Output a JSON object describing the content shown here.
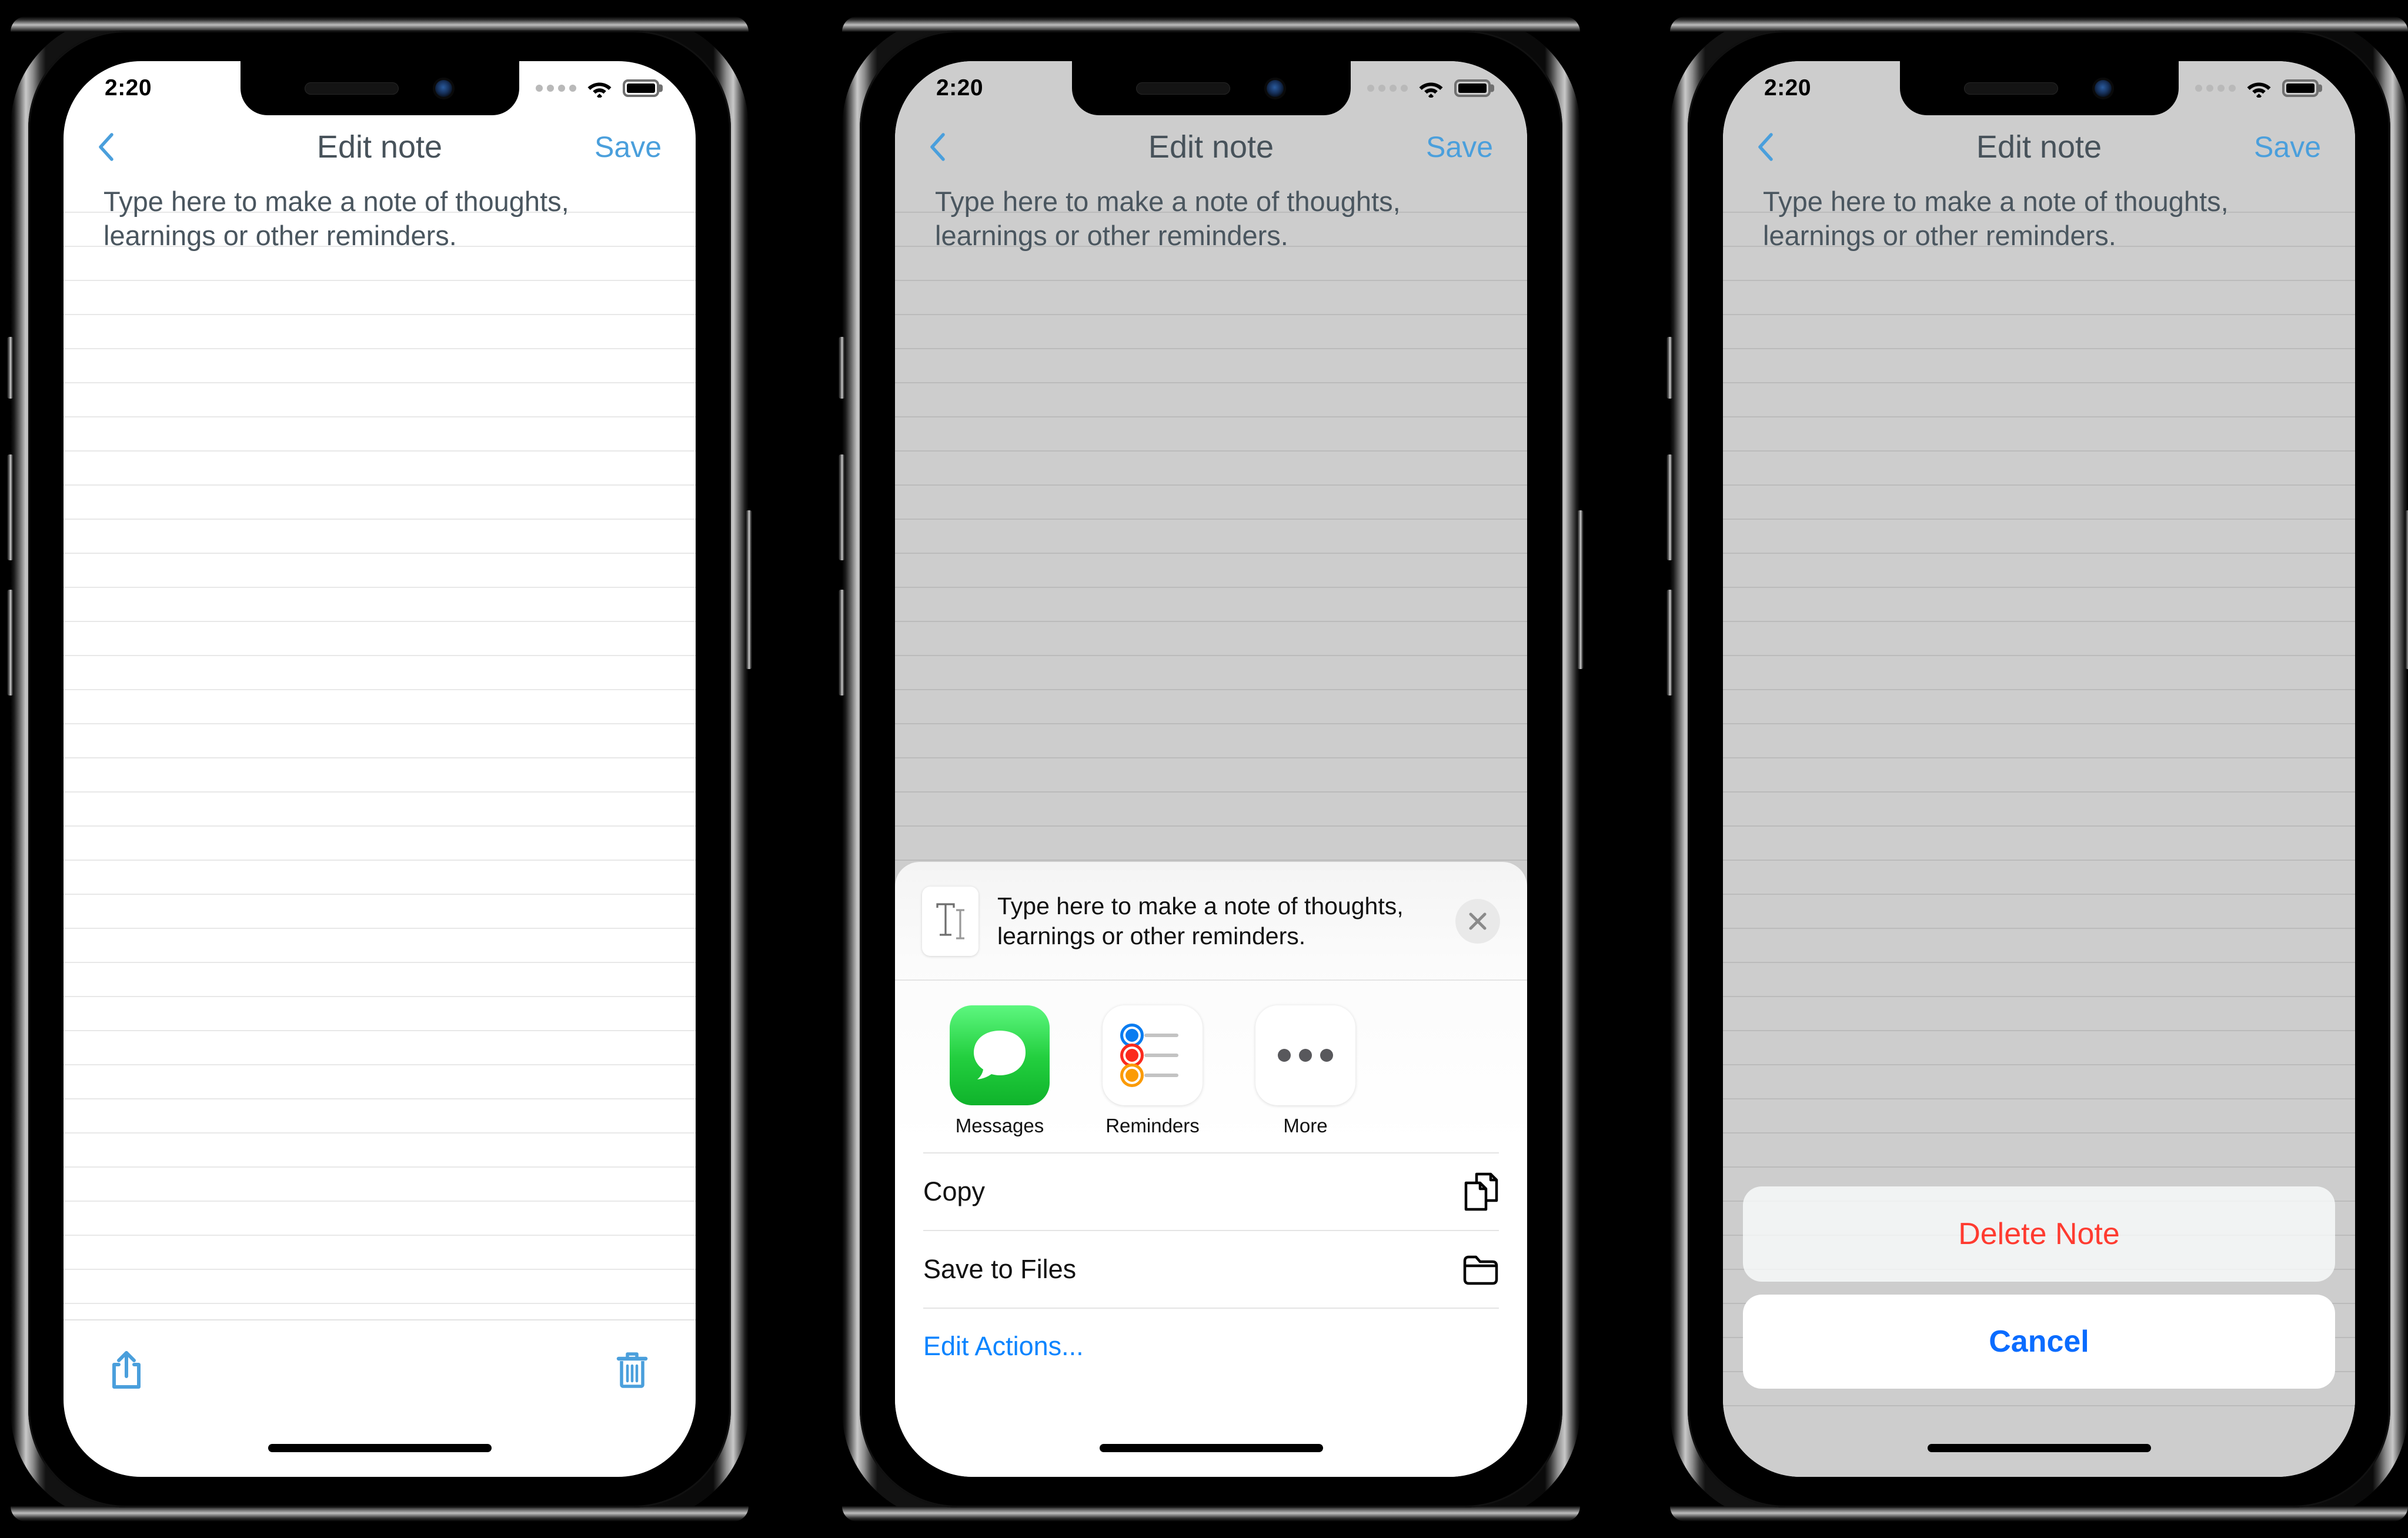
{
  "meta": {
    "app": "Edit note",
    "platform": "iOS",
    "screens": 3
  },
  "status_bar": {
    "time": "2:20",
    "signal_dots": 4,
    "wifi_icon": "wifi-icon",
    "battery_icon": "battery-full-icon",
    "battery_level": "100%"
  },
  "nav_bar": {
    "back_icon": "chevron-left-icon",
    "title": "Edit note",
    "save_label": "Save",
    "accent_color": "#4a9fdc",
    "title_color": "#47525a"
  },
  "note": {
    "line1": "Type here to make a note of thoughts,",
    "line2": "learnings or other reminders.",
    "full_text": "Type here to make a note of thoughts, learnings or other reminders.",
    "text_color": "#4a565f"
  },
  "toolbar": {
    "share_icon": "share-icon",
    "delete_icon": "trash-icon",
    "icon_color": "#4a9fdc"
  },
  "share_sheet": {
    "preview_icon": "text-document-icon",
    "preview_line1": "Type here to make a note of thoughts,",
    "preview_line2": "learnings or other reminders.",
    "close_icon": "close-x-icon",
    "apps": [
      {
        "label": "Messages",
        "icon": "messages-icon",
        "color": "#23cf3f"
      },
      {
        "label": "Reminders",
        "icon": "reminders-icon",
        "color": "#ffffff"
      },
      {
        "label": "More",
        "icon": "more-dots-icon",
        "color": "#ffffff"
      }
    ],
    "actions": [
      {
        "label": "Copy",
        "icon": "copy-pages-icon"
      },
      {
        "label": "Save to Files",
        "icon": "folder-icon"
      }
    ],
    "edit_actions_label": "Edit Actions...",
    "edit_actions_color": "#0a84ff"
  },
  "action_sheet": {
    "destructive_label": "Delete Note",
    "destructive_color": "#ff3b30",
    "cancel_label": "Cancel",
    "cancel_color": "#0a6cff"
  },
  "colors": {
    "dim_overlay": "#cdcdcd",
    "screen_background": "#ffffff",
    "rule_line": "rgba(0,0,0,0.09)"
  }
}
